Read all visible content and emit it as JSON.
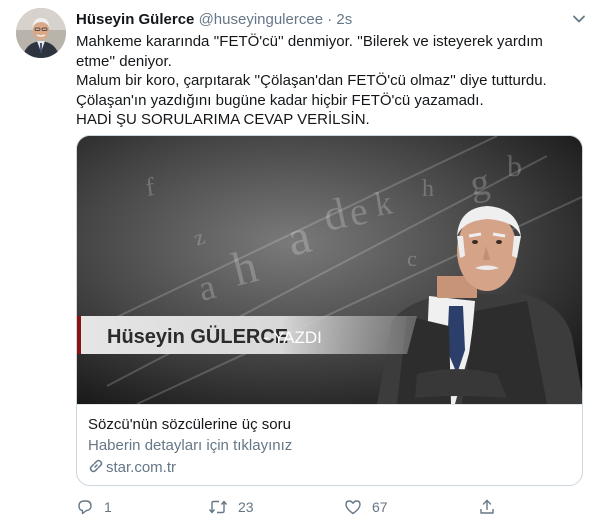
{
  "tweet": {
    "name": "Hüseyin Gülerce",
    "handle": "@huseyingulercee",
    "separator": "·",
    "time": "2s",
    "lines": [
      "Mahkeme kararında ''FETÖ'cü'' denmiyor. ''Bilerek ve isteyerek yardım",
      "etme'' deniyor.",
      "Malum bir koro, çarpıtarak ''Çölaşan'dan FETÖ'cü olmaz'' diye tutturdu.",
      "Çölaşan'ın yazdığını bugüne kadar hiçbir FETÖ'cü yazamadı.",
      "HADİ ŞU SORULARIMA CEVAP VERİLSİN."
    ]
  },
  "card": {
    "banner_name": "Hüseyin GÜLERCE",
    "banner_sep": " - ",
    "banner_sub": "YAZDI",
    "title": "Sözcü'nün sözcülerine üç soru",
    "description": "Haberin detayları için tıklayınız",
    "domain": "star.com.tr"
  },
  "actions": {
    "reply_count": "1",
    "retweet_count": "23",
    "like_count": "67"
  },
  "icons": {
    "caret": "chevron-down-icon",
    "link": "link-icon",
    "reply": "reply-icon",
    "retweet": "retweet-icon",
    "like": "heart-icon",
    "share": "share-icon"
  },
  "colors": {
    "text": "#14171a",
    "secondary": "#657786",
    "border": "#ccd6dd"
  }
}
